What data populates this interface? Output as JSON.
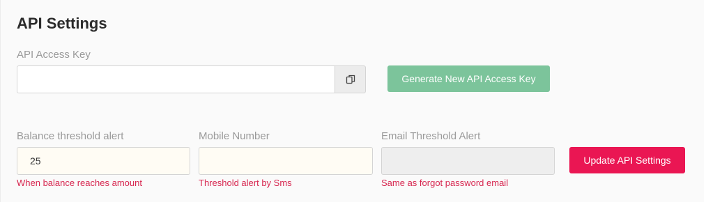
{
  "title": "API Settings",
  "api_key": {
    "label": "API Access Key",
    "value": "",
    "copy_icon": "copy-icon",
    "generate_label": "Generate New API Access Key",
    "generate_color": "#7cc49b"
  },
  "balance_threshold": {
    "label": "Balance threshold alert",
    "value": "25",
    "help": "When balance reaches amount"
  },
  "mobile_number": {
    "label": "Mobile Number",
    "value": "",
    "help": "Threshold alert by Sms"
  },
  "email_threshold": {
    "label": "Email Threshold Alert",
    "value": "",
    "help": "Same as forgot password email"
  },
  "update_label": "Update API Settings",
  "colors": {
    "accent": "#ea1653",
    "help_text": "#d7264f"
  }
}
